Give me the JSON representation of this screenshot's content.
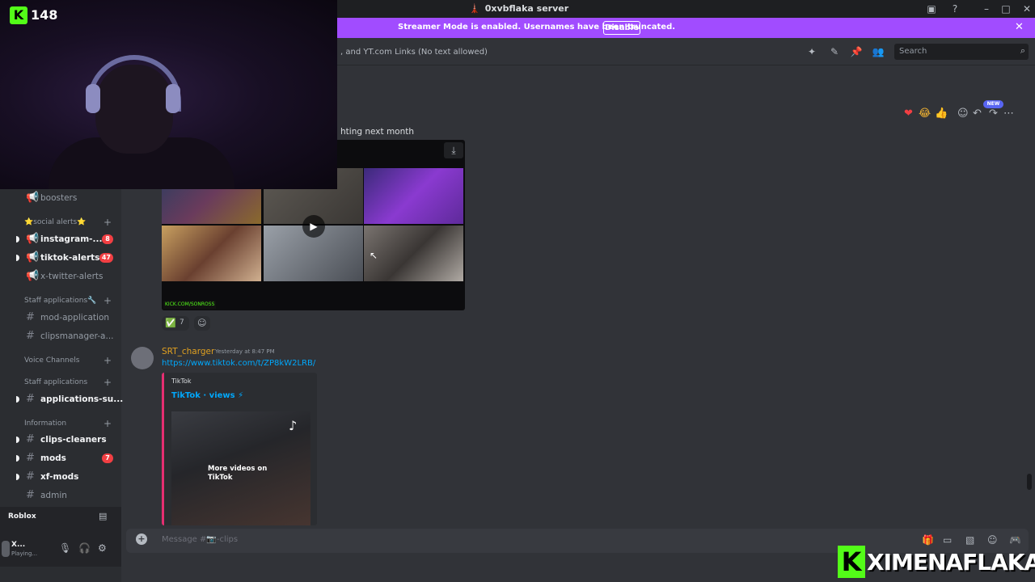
{
  "window": {
    "title": "0xvbflaka server",
    "title_emoji": "🗼"
  },
  "banner": {
    "message": "Streamer Mode is enabled. Usernames have been truncated.",
    "disable_label": "Disable"
  },
  "header": {
    "topic": ", and YT.com Links (No text allowed)",
    "search_placeholder": "Search"
  },
  "stream": {
    "viewer_count": "148",
    "brand_text": "XIMENAFLAKA"
  },
  "sidebar": {
    "channels_top": [
      {
        "name": "boosters",
        "bold": false
      }
    ],
    "categories": {
      "social": "⭐social alerts⭐",
      "staff1": "Staff applications🔧",
      "voice": "Voice Channels",
      "staff2": "Staff applications",
      "info": "Information"
    },
    "social_channels": [
      {
        "name": "instagram-...",
        "badge": "8"
      },
      {
        "name": "tiktok-alerts",
        "badge": "47"
      },
      {
        "name": "x-twitter-alerts",
        "badge": ""
      }
    ],
    "staff_channels": [
      {
        "name": "mod-application"
      },
      {
        "name": "clipsmanager-a..."
      }
    ],
    "staff2_channels": [
      {
        "name": "applications-su..."
      }
    ],
    "info_channels": [
      {
        "name": "clips-cleaners",
        "badge": ""
      },
      {
        "name": "mods",
        "badge": "7"
      },
      {
        "name": "xf-mods",
        "badge": ""
      },
      {
        "name": "admin",
        "badge": ""
      }
    ],
    "voice_status": "Roblox",
    "user": {
      "name": "X...",
      "status": "Playing..."
    }
  },
  "message1": {
    "text": "hting next month",
    "watermark": "KICK.COM/SONROSS",
    "reaction_count": "7",
    "new_tag": "NEW"
  },
  "message2": {
    "author": "SRT_charger",
    "time": "Yesterday at 8:47 PM",
    "link": "https://www.tiktok.com/t/ZP8kW2LRB/",
    "embed_provider": "TikTok",
    "embed_title": "TikTok · views ⚡",
    "embed_more": "More videos on TikTok"
  },
  "composer": {
    "placeholder": "Message #📷-clips"
  },
  "colors": {
    "accent": "#a14cff",
    "kick_green": "#53fc18",
    "link": "#00a8fc",
    "badge": "#f23f43"
  }
}
